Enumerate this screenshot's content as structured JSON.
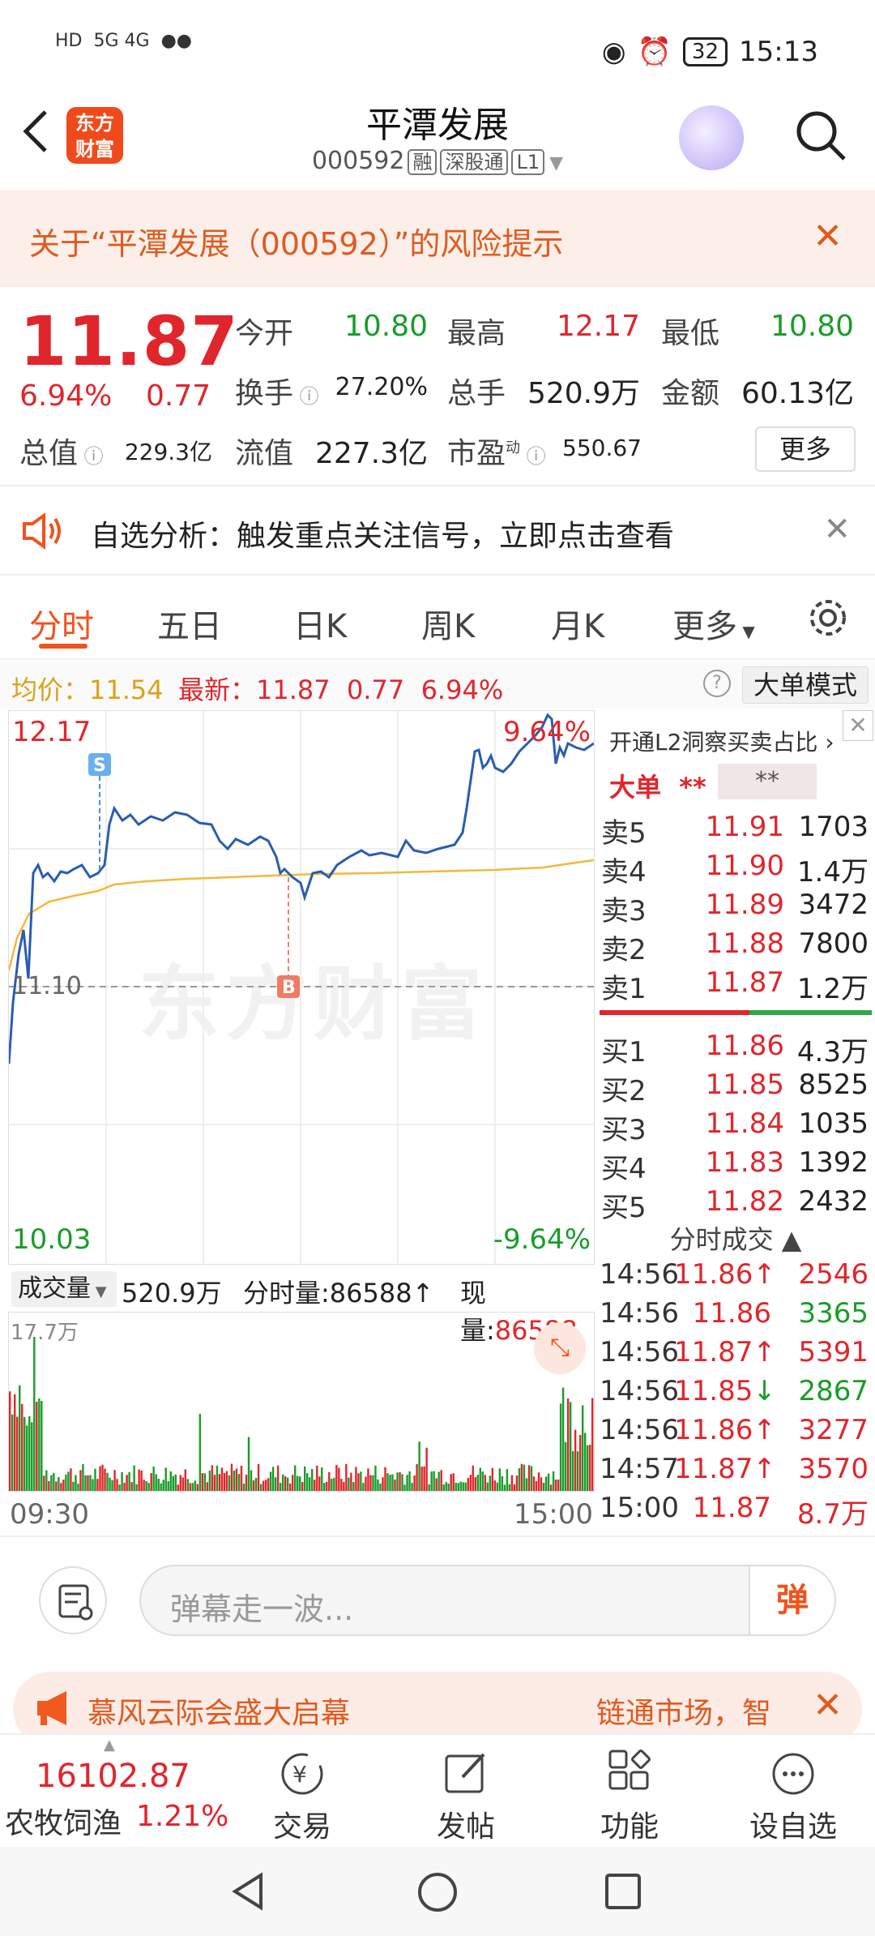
{
  "status_bar": {
    "time": "15:13",
    "battery": "32",
    "network": "5G 4G",
    "hd": "HD"
  },
  "header": {
    "logo_text": "东方财富",
    "title": "平潭发展",
    "code": "000592",
    "tags": [
      "融",
      "深股通",
      "L1"
    ]
  },
  "risk_banner": {
    "text": "关于“平潭发展（000592）”的风险提示"
  },
  "quote": {
    "price": "11.87",
    "change_pct": "6.94%",
    "change": "0.77",
    "open_label": "今开",
    "open": "10.80",
    "high_label": "最高",
    "high": "12.17",
    "low_label": "最低",
    "low": "10.80",
    "turnover_label": "换手",
    "turnover": "27.20%",
    "volume_label": "总手",
    "volume": "520.9万",
    "amount_label": "金额",
    "amount": "60.13亿",
    "mktcap_label": "总值",
    "mktcap": "229.3亿",
    "float_label": "流值",
    "float": "227.3亿",
    "pe_label": "市盈",
    "pe_sup": "动",
    "pe": "550.67",
    "more_button": "更多"
  },
  "notice": {
    "text": "自选分析：触发重点关注信号，立即点击查看"
  },
  "tabs": {
    "items": [
      "分时",
      "五日",
      "日K",
      "周K",
      "月K",
      "更多"
    ],
    "active": "分时"
  },
  "chart_header": {
    "avg_label": "均价：",
    "avg": "11.54",
    "new_label": "最新：",
    "new": "11.87",
    "change": "0.77",
    "change_pct": "6.94%",
    "help": "?",
    "mode_button": "大单模式"
  },
  "chart_labels": {
    "max_price": "12.17",
    "max_pct": "9.64%",
    "min_price": "10.03",
    "min_pct": "-9.64%",
    "prev_close": "11.10",
    "marker_s": "S",
    "marker_b": "B",
    "watermark": "东方财富"
  },
  "volume": {
    "select_label": "成交量",
    "total": "520.9万",
    "minute_label": "分时量:86588",
    "current_label": "现量:",
    "current": "86588",
    "max_label": "17.7万",
    "time_start": "09:30",
    "time_end": "15:00"
  },
  "order_book": {
    "header": "开通L2洞察买卖占比",
    "dadan": "大单",
    "dadan_stars": "**",
    "dadan_stars2": "**",
    "asks": [
      {
        "label": "卖5",
        "price": "11.91",
        "vol": "1703"
      },
      {
        "label": "卖4",
        "price": "11.90",
        "vol": "1.4万"
      },
      {
        "label": "卖3",
        "price": "11.89",
        "vol": "3472"
      },
      {
        "label": "卖2",
        "price": "11.88",
        "vol": "7800"
      },
      {
        "label": "卖1",
        "price": "11.87",
        "vol": "1.2万"
      }
    ],
    "bids": [
      {
        "label": "买1",
        "price": "11.86",
        "vol": "4.3万"
      },
      {
        "label": "买2",
        "price": "11.85",
        "vol": "8525"
      },
      {
        "label": "买3",
        "price": "11.84",
        "vol": "1035"
      },
      {
        "label": "买4",
        "price": "11.83",
        "vol": "1392"
      },
      {
        "label": "买5",
        "price": "11.82",
        "vol": "2432"
      }
    ],
    "trades_header": "分时成交",
    "trades": [
      {
        "time": "14:56",
        "price": "11.86",
        "dir": "↑",
        "vol": "2546",
        "color": "red"
      },
      {
        "time": "14:56",
        "price": "11.86",
        "dir": "",
        "vol": "3365",
        "color": "green"
      },
      {
        "time": "14:56",
        "price": "11.87",
        "dir": "↑",
        "vol": "5391",
        "color": "red"
      },
      {
        "time": "14:56",
        "price": "11.85",
        "dir": "↓",
        "vol": "2867",
        "color": "green"
      },
      {
        "time": "14:56",
        "price": "11.86",
        "dir": "↑",
        "vol": "3277",
        "color": "red"
      },
      {
        "time": "14:57",
        "price": "11.87",
        "dir": "↑",
        "vol": "3570",
        "color": "red"
      },
      {
        "time": "15:00",
        "price": "11.87",
        "dir": "",
        "vol": "8.7万",
        "color": "red"
      }
    ]
  },
  "comment": {
    "placeholder": "弹幕走一波...",
    "send": "弹"
  },
  "promo": {
    "text1": "慕风云际会盛大启幕",
    "text2": "链通市场，智"
  },
  "bottom_nav": {
    "index_value": "16102.87",
    "index_name": "农牧饲渔",
    "index_change": "1.21%",
    "items": [
      "交易",
      "发帖",
      "功能",
      "设自选"
    ]
  },
  "colors": {
    "accent": "#f0531c",
    "up": "#e0262c",
    "down": "#1a9c2a",
    "price_line": "#2a5db0",
    "avg_line": "#f2b93b"
  }
}
